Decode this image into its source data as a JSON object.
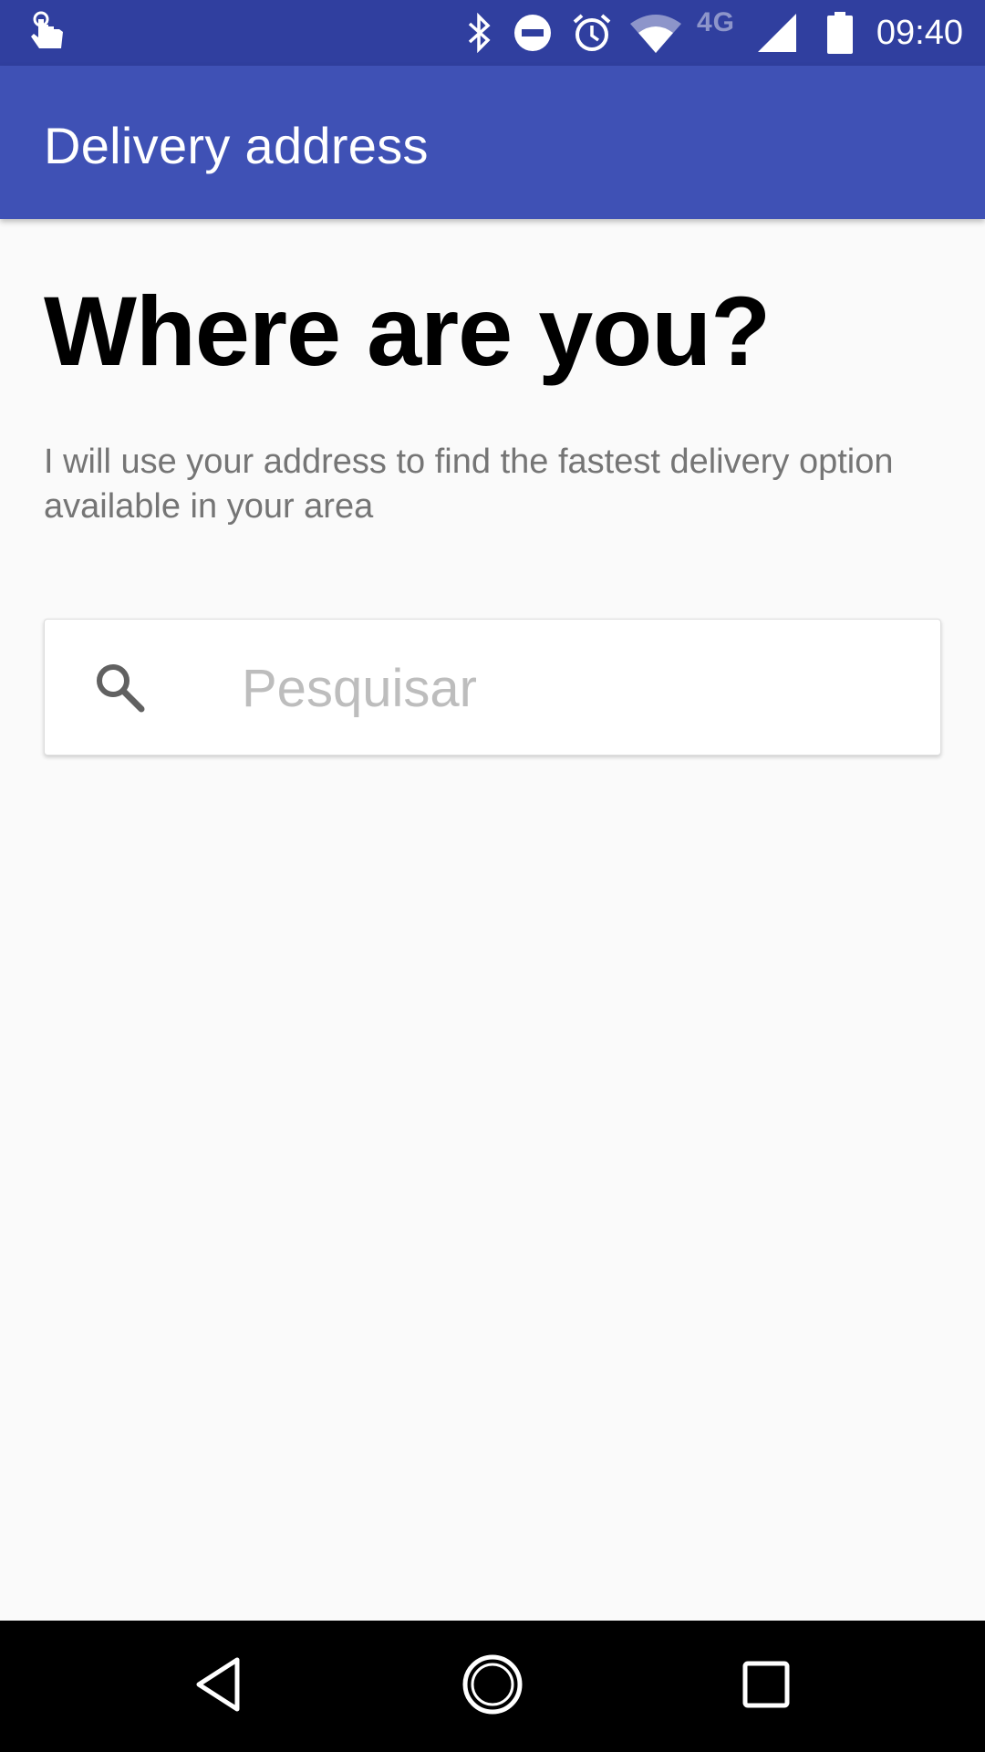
{
  "status_bar": {
    "time": "09:40",
    "network_label": "4G",
    "icons": [
      "touch-icon",
      "bluetooth-icon",
      "do-not-disturb-icon",
      "alarm-icon",
      "wifi-icon",
      "cellular-signal-icon",
      "battery-icon"
    ]
  },
  "app_bar": {
    "title": "Delivery address",
    "color": "#3f51b5",
    "status_color": "#303f9f"
  },
  "main": {
    "heading": "Where are you?",
    "subtitle": "I will use your address to find the fastest delivery option available in your area",
    "search": {
      "placeholder": "Pesquisar",
      "value": "",
      "icon": "search-icon"
    }
  },
  "nav_bar": {
    "buttons": [
      "back-icon",
      "home-icon",
      "recents-icon"
    ]
  }
}
